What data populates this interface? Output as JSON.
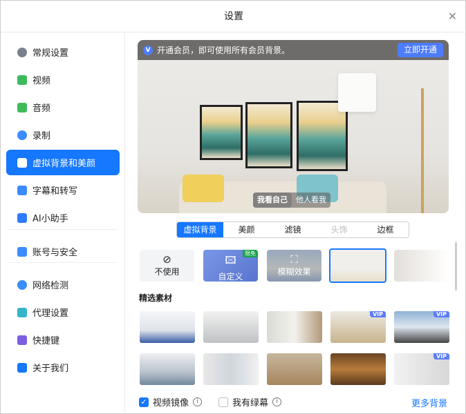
{
  "window": {
    "title": "设置",
    "close_icon": "close-icon"
  },
  "sidebar": {
    "items": [
      {
        "label": "常规设置",
        "icon": "gear-icon",
        "color": "#7a7f8c"
      },
      {
        "label": "视频",
        "icon": "video-camera-icon",
        "color": "#3dbb5a"
      },
      {
        "label": "音频",
        "icon": "speaker-icon",
        "color": "#3dbb5a"
      },
      {
        "label": "录制",
        "icon": "record-icon",
        "color": "#3b8cff"
      },
      {
        "label": "虚拟背景和美颜",
        "icon": "portrait-icon",
        "color": "#ffffff"
      },
      {
        "label": "字幕和转写",
        "icon": "subtitle-icon",
        "color": "#3b8cff"
      },
      {
        "label": "AI小助手",
        "icon": "ai-assistant-icon",
        "color": "#2f7bff"
      },
      {
        "label": "账号与安全",
        "icon": "account-security-icon",
        "color": "#3b8cff"
      },
      {
        "label": "网络检测",
        "icon": "globe-icon",
        "color": "#3b8cff"
      },
      {
        "label": "代理设置",
        "icon": "proxy-network-icon",
        "color": "#35b5c8"
      },
      {
        "label": "快捷键",
        "icon": "keyboard-icon",
        "color": "#7b5fe0"
      },
      {
        "label": "关于我们",
        "icon": "logo-icon",
        "color": "#1677ff"
      }
    ],
    "active": 4
  },
  "banner": {
    "text": "开通会员，即可使用所有会员背景。",
    "badge": "V",
    "button": "立即开通"
  },
  "preview": {
    "view_toggle": [
      "我看自己",
      "他人看我"
    ],
    "active_view": 0
  },
  "tabs": [
    {
      "label": "虚拟背景",
      "state": "active"
    },
    {
      "label": "美颜",
      "state": "normal"
    },
    {
      "label": "滤镜",
      "state": "normal"
    },
    {
      "label": "头饰",
      "state": "disabled"
    },
    {
      "label": "边框",
      "state": "normal"
    }
  ],
  "options": [
    {
      "label": "不使用",
      "icon": "no-entry-icon"
    },
    {
      "label": "自定义",
      "icon": "add-image-icon",
      "badge": "限免"
    },
    {
      "label": "模糊效果",
      "icon": "blur-person-icon"
    }
  ],
  "section_title": "精选素材",
  "materials_vip": [
    false,
    false,
    false,
    true,
    true,
    false,
    false,
    false,
    false,
    true
  ],
  "footer": {
    "mirror_label": "视频镜像",
    "mirror_checked": true,
    "greenscreen_label": "我有绿幕",
    "greenscreen_checked": false,
    "more_link": "更多背景"
  },
  "colors": {
    "accent": "#1677ff",
    "vip": "#5b7cf6"
  }
}
